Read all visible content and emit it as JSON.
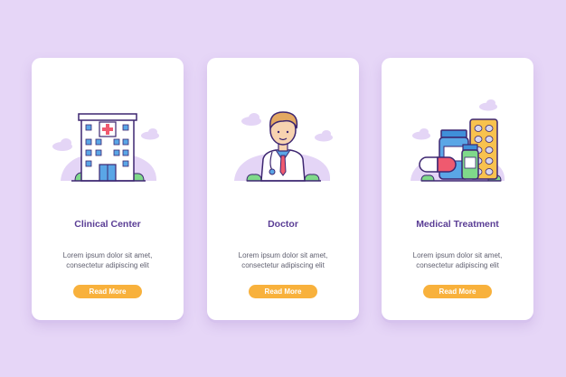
{
  "cards": [
    {
      "title": "Clinical Center",
      "description_line1": "Lorem ipsum dolor sit amet,",
      "description_line2": "consectetur adipiscing elit",
      "button_label": "Read More",
      "icon": "hospital-building-icon"
    },
    {
      "title": "Doctor",
      "description_line1": "Lorem ipsum dolor sit amet,",
      "description_line2": "consectetur adipiscing elit",
      "button_label": "Read More",
      "icon": "doctor-icon"
    },
    {
      "title": "Medical Treatment",
      "description_line1": "Lorem ipsum dolor sit amet,",
      "description_line2": "consectetur adipiscing elit",
      "button_label": "Read More",
      "icon": "medicine-icon"
    }
  ],
  "colors": {
    "background": "#e6d6f7",
    "accent_purple": "#5a3d95",
    "button_orange": "#f8b13c",
    "blob": "#e4d5f6",
    "shrub_green": "#7fd98a"
  }
}
